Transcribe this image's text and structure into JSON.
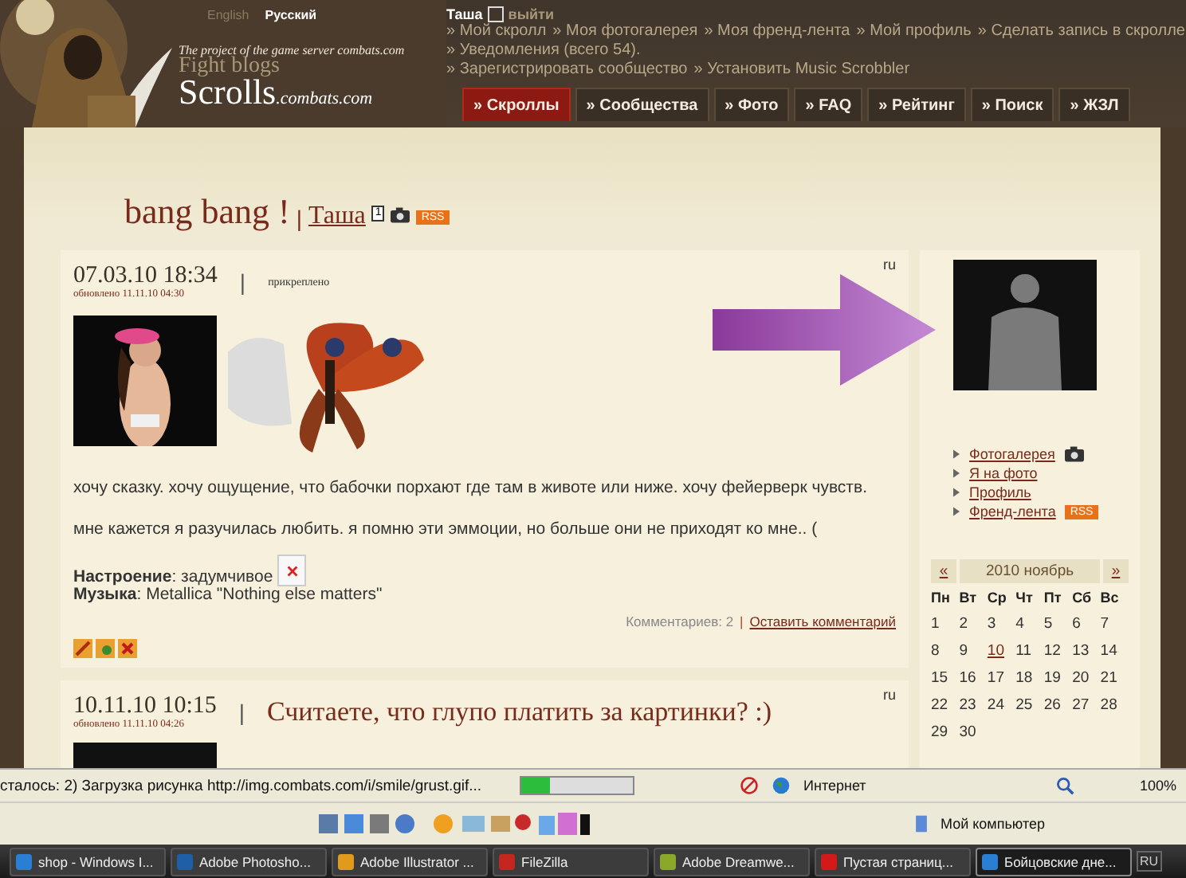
{
  "header": {
    "languages": [
      {
        "label": "English",
        "selected": false
      },
      {
        "label": "Русский",
        "selected": true
      }
    ],
    "logo": {
      "tagline": "The project of the game server combats.com",
      "subtitle": "Fight blogs",
      "name": "Scrolls",
      "domain": ".combats.com"
    },
    "user": {
      "name": "Таша",
      "logout": "выйти"
    },
    "link_lines": [
      [
        "» Мой скролл",
        "» Моя фотогалерея",
        "» Моя френд-лента",
        "» Мой профиль",
        "» Сделать запись в скролле"
      ],
      [
        "» Уведомления (всего 54)."
      ],
      [
        "» Зарегистрировать сообщество",
        "» Установить Music Scrobbler"
      ]
    ],
    "tabs": [
      {
        "label": "» Скроллы",
        "selected": true
      },
      {
        "label": "» Сообщества",
        "selected": false
      },
      {
        "label": "» Фото",
        "selected": false
      },
      {
        "label": "» FAQ",
        "selected": false
      },
      {
        "label": "» Рейтинг",
        "selected": false
      },
      {
        "label": "» Поиск",
        "selected": false
      },
      {
        "label": "» ЖЗЛ",
        "selected": false
      }
    ]
  },
  "blog": {
    "title": "bang bang !",
    "separator": "|",
    "author": "Таша",
    "badge": "1",
    "rss": "RSS"
  },
  "posts": [
    {
      "date": "07.03.10 18:34",
      "updated": "обновлено 11.11.10 04:30",
      "separator": "|",
      "pinned": "прикреплено",
      "lang": "ru",
      "paragraphs": [
        "хочу сказку. хочу ощущение, что бабочки порхают где там в животе или ниже. хочу фейерверк чувств.",
        "мне кажется я разучилась любить. я помню эти эммоции, но больше они не приходят ко мне.. ("
      ],
      "mood": {
        "label": "Настроение",
        "value": ": задумчивое"
      },
      "music": {
        "label": "Музыка",
        "value": ": Metallica \"Nothing else matters\""
      },
      "comments": "Комментариев: 2",
      "comments_separator": "|",
      "leave_comment": "Оставить комментарий"
    },
    {
      "date": "10.11.10 10:15",
      "updated": "обновлено 11.11.10 04:26",
      "separator": "|",
      "title": "Считаете, что глупо платить за картинки? :)",
      "lang": "ru"
    }
  ],
  "sidebar": {
    "links": [
      {
        "label": "Фотогалерея",
        "kind": "camera"
      },
      {
        "label": "Я на фото",
        "kind": "plain"
      },
      {
        "label": "Профиль",
        "kind": "plain"
      },
      {
        "label": "Френд-лента",
        "kind": "rss",
        "badge": "RSS"
      }
    ],
    "calendar": {
      "prev": "«",
      "month": "2010 ноябрь",
      "next": "»",
      "weekdays": [
        "Пн",
        "Вт",
        "Ср",
        "Чт",
        "Пт",
        "Сб",
        "Вс"
      ],
      "weeks": [
        [
          {
            "day": "1",
            "link": false
          },
          {
            "day": "2",
            "link": false
          },
          {
            "day": "3",
            "link": false
          },
          {
            "day": "4",
            "link": false
          },
          {
            "day": "5",
            "link": false
          },
          {
            "day": "6",
            "link": false
          },
          {
            "day": "7",
            "link": false
          }
        ],
        [
          {
            "day": "8",
            "link": false
          },
          {
            "day": "9",
            "link": false
          },
          {
            "day": "10",
            "link": true
          },
          {
            "day": "11",
            "link": false
          },
          {
            "day": "12",
            "link": false
          },
          {
            "day": "13",
            "link": false
          },
          {
            "day": "14",
            "link": false
          }
        ],
        [
          {
            "day": "15",
            "link": false
          },
          {
            "day": "16",
            "link": false
          },
          {
            "day": "17",
            "link": false
          },
          {
            "day": "18",
            "link": false
          },
          {
            "day": "19",
            "link": false
          },
          {
            "day": "20",
            "link": false
          },
          {
            "day": "21",
            "link": false
          }
        ],
        [
          {
            "day": "22",
            "link": false
          },
          {
            "day": "23",
            "link": false
          },
          {
            "day": "24",
            "link": false
          },
          {
            "day": "25",
            "link": false
          },
          {
            "day": "26",
            "link": false
          },
          {
            "day": "27",
            "link": false
          },
          {
            "day": "28",
            "link": false
          }
        ],
        [
          {
            "day": "29",
            "link": false
          },
          {
            "day": "30",
            "link": false
          }
        ]
      ]
    }
  },
  "status_bar": {
    "text": "сталось: 2) Загрузка рисунка http://img.combats.com/i/smile/grust.gif...",
    "level": 0.25,
    "zone": "Интернет",
    "zoom": "100%"
  },
  "links_bar": {
    "label": "Мой компьютер"
  },
  "taskbar": [
    {
      "label": "shop - Windows I...",
      "kind": "ie",
      "selected": false
    },
    {
      "label": "Adobe Photosho...",
      "kind": "ps",
      "selected": false
    },
    {
      "label": "Adobe Illustrator ...",
      "kind": "ai",
      "selected": false
    },
    {
      "label": "FileZilla",
      "kind": "fz",
      "selected": false
    },
    {
      "label": "Adobe Dreamwe...",
      "kind": "dw",
      "selected": false
    },
    {
      "label": "Пустая страниц...",
      "kind": "opera",
      "selected": false
    },
    {
      "label": "Бойцовские дне...",
      "kind": "ie",
      "selected": true
    }
  ],
  "tray": {
    "lang": "RU"
  }
}
